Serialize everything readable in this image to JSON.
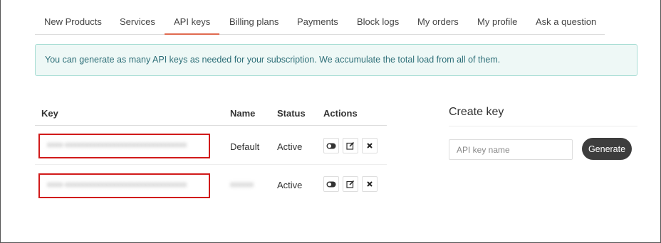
{
  "tabs": [
    {
      "label": "New Products"
    },
    {
      "label": "Services"
    },
    {
      "label": "API keys",
      "active": true
    },
    {
      "label": "Billing plans"
    },
    {
      "label": "Payments"
    },
    {
      "label": "Block logs"
    },
    {
      "label": "My orders"
    },
    {
      "label": "My profile"
    },
    {
      "label": "Ask a question"
    }
  ],
  "alert": {
    "text": "You can generate as many API keys as needed for your subscription. We accumulate the total load from all of them."
  },
  "table": {
    "headers": {
      "key": "Key",
      "name": "Name",
      "status": "Status",
      "actions": "Actions"
    },
    "rows": [
      {
        "key": "",
        "name": "Default",
        "status": "Active"
      },
      {
        "key": "",
        "name": "",
        "status": "Active"
      }
    ]
  },
  "create": {
    "title": "Create key",
    "input_placeholder": "API key name",
    "button_label": "Generate"
  },
  "colors": {
    "active_tab_underline": "#e06a4f",
    "alert_bg": "#eef8f6",
    "alert_text": "#2e6f78",
    "key_highlight": "#d11a1a",
    "generate_button": "#3d3d3d"
  },
  "icons": [
    "toggle-icon",
    "edit-icon",
    "delete-icon"
  ]
}
